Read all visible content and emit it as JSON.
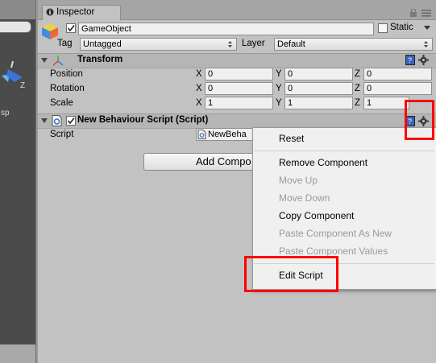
{
  "window": {
    "tab_title": "Inspector"
  },
  "scene": {
    "axis_label": "Z",
    "persp_text": "sp"
  },
  "gameobject": {
    "name": "GameObject",
    "static_label": "Static",
    "tag_label": "Tag",
    "tag_value": "Untagged",
    "layer_label": "Layer",
    "layer_value": "Default"
  },
  "transform": {
    "title": "Transform",
    "rows": [
      {
        "label": "Position",
        "x": "0",
        "y": "0",
        "z": "0"
      },
      {
        "label": "Rotation",
        "x": "0",
        "y": "0",
        "z": "0"
      },
      {
        "label": "Scale",
        "x": "1",
        "y": "1",
        "z": "1"
      }
    ],
    "axis": {
      "x": "X",
      "y": "Y",
      "z": "Z"
    }
  },
  "behaviour": {
    "title": "New Behaviour Script (Script)",
    "script_label": "Script",
    "script_value": "NewBeha"
  },
  "add_component_label": "Add Compo",
  "context_menu": {
    "items": [
      {
        "label": "Reset",
        "enabled": true
      },
      {
        "label": "Remove Component",
        "enabled": true
      },
      {
        "label": "Move Up",
        "enabled": false
      },
      {
        "label": "Move Down",
        "enabled": false
      },
      {
        "label": "Copy Component",
        "enabled": true
      },
      {
        "label": "Paste Component As New",
        "enabled": false
      },
      {
        "label": "Paste Component Values",
        "enabled": false
      },
      {
        "label": "Edit Script",
        "enabled": true
      }
    ]
  },
  "colors": {
    "highlight": "#ff0000",
    "panel": "#c2c2c2",
    "scene": "#4b4b4b"
  }
}
